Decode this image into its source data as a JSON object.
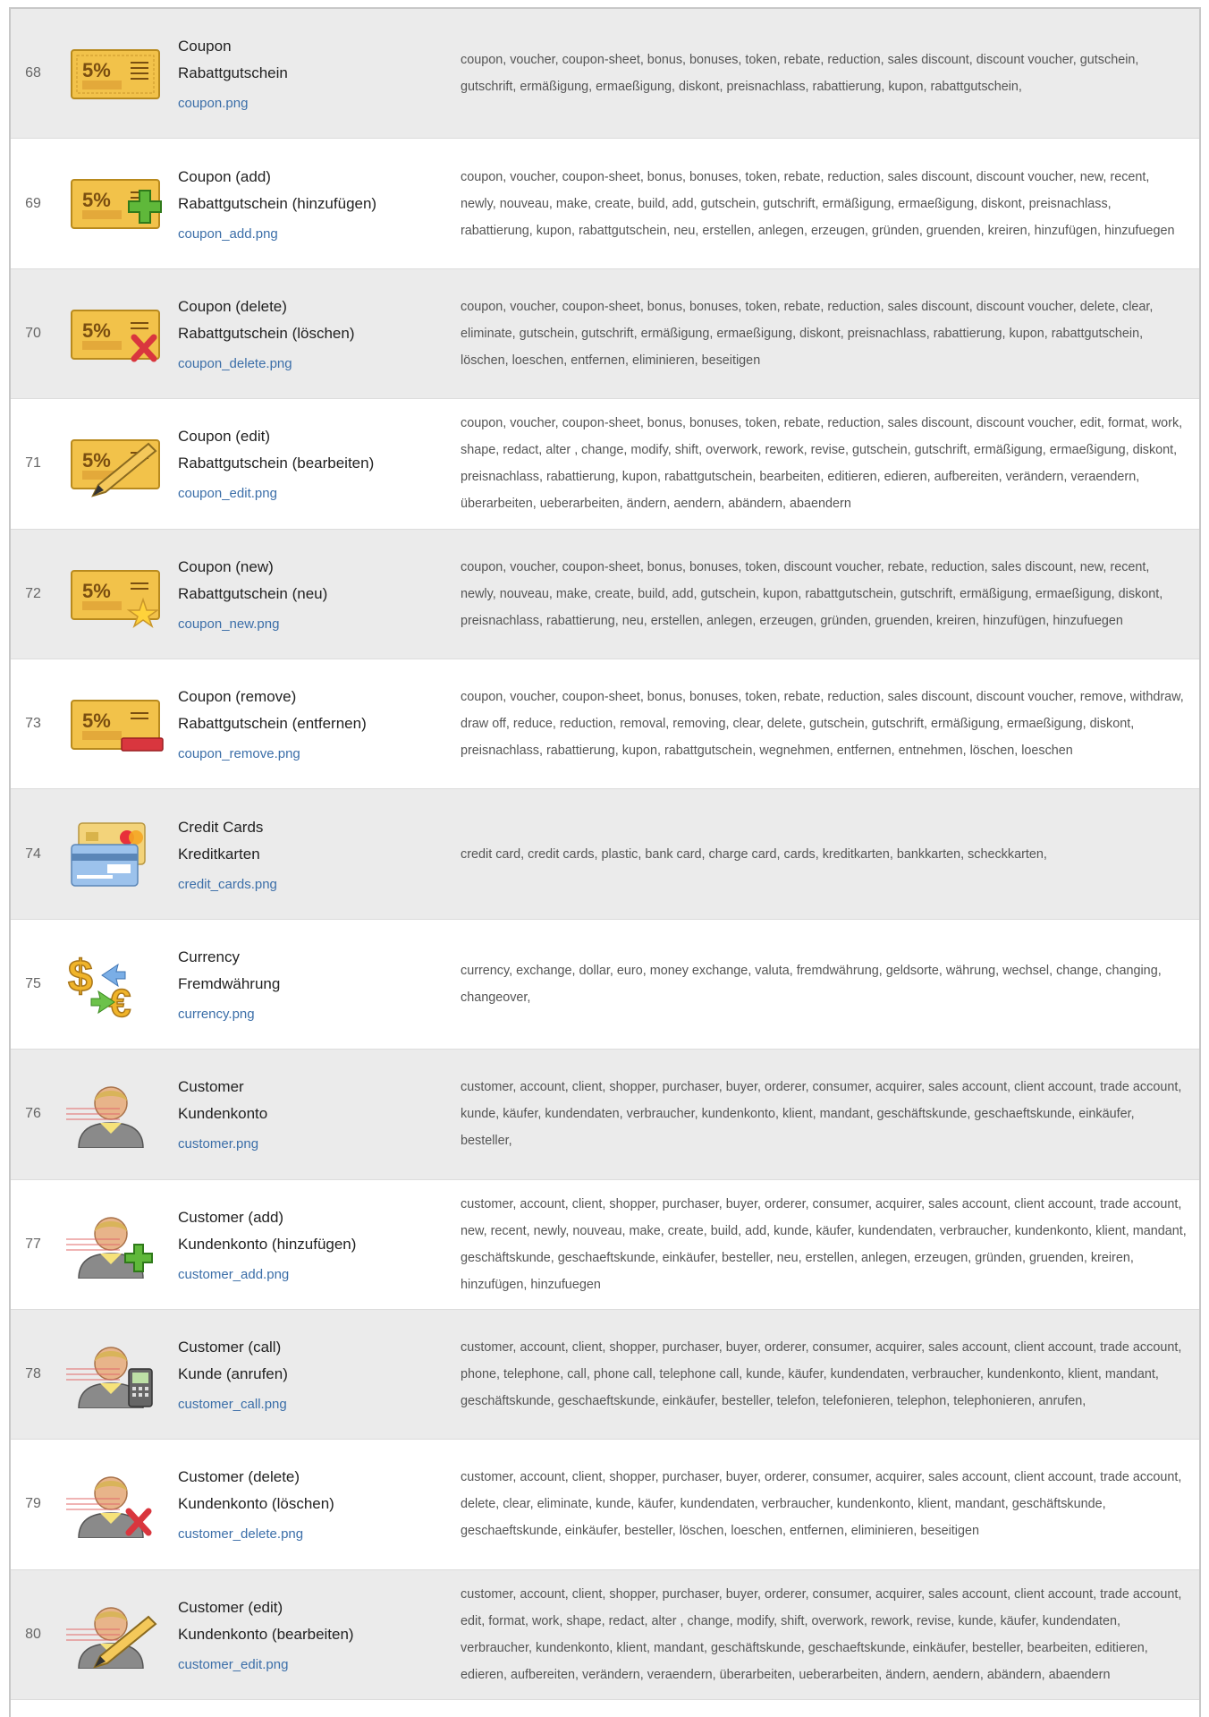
{
  "colors": {
    "row_odd": "#ebebeb",
    "row_even": "#ffffff",
    "link": "#3b6ea8",
    "coupon_gold": "#f2c24a",
    "add_green": "#5fb83a",
    "delete_red": "#d9363e"
  },
  "rows": [
    {
      "num": "68",
      "icon": "coupon-icon",
      "en": "Coupon",
      "de": "Rabattgutschein",
      "file": "coupon.png",
      "keywords": "coupon, voucher, coupon-sheet, bonus, bonuses, token, rebate, reduction, sales discount, discount voucher, gutschein, gutschrift, ermäßigung, ermaeßigung, diskont, preisnachlass, rabattierung, kupon, rabattgutschein,"
    },
    {
      "num": "69",
      "icon": "coupon-add-icon",
      "en": "Coupon (add)",
      "de": "Rabattgutschein (hinzufügen)",
      "file": "coupon_add.png",
      "keywords": "coupon, voucher, coupon-sheet, bonus, bonuses, token, rebate, reduction, sales discount, discount voucher, new, recent, newly, nouveau, make, create, build, add, gutschein, gutschrift, ermäßigung, ermaeßigung, diskont, preisnachlass, rabattierung, kupon, rabattgutschein, neu, erstellen, anlegen, erzeugen, gründen, gruenden, kreiren, hinzufügen, hinzufuegen"
    },
    {
      "num": "70",
      "icon": "coupon-delete-icon",
      "en": "Coupon (delete)",
      "de": "Rabattgutschein (löschen)",
      "file": "coupon_delete.png",
      "keywords": "coupon, voucher, coupon-sheet, bonus, bonuses, token, rebate, reduction, sales discount, discount voucher, delete, clear, eliminate, gutschein, gutschrift, ermäßigung, ermaeßigung, diskont, preisnachlass, rabattierung, kupon, rabattgutschein, löschen, loeschen, entfernen, eliminieren, beseitigen"
    },
    {
      "num": "71",
      "icon": "coupon-edit-icon",
      "en": "Coupon (edit)",
      "de": "Rabattgutschein (bearbeiten)",
      "file": "coupon_edit.png",
      "keywords": "coupon, voucher, coupon-sheet, bonus, bonuses, token, rebate, reduction, sales discount, discount voucher, edit, format, work, shape, redact, alter , change, modify, shift, overwork, rework, revise, gutschein, gutschrift, ermäßigung, ermaeßigung, diskont, preisnachlass, rabattierung, kupon, rabattgutschein, bearbeiten, editieren, edieren, aufbereiten, verändern, veraendern, überarbeiten, ueberarbeiten, ändern, aendern, abändern, abaendern"
    },
    {
      "num": "72",
      "icon": "coupon-new-icon",
      "en": "Coupon (new)",
      "de": "Rabattgutschein (neu)",
      "file": "coupon_new.png",
      "keywords": "coupon, voucher, coupon-sheet, bonus, bonuses, token, discount voucher, rebate, reduction, sales discount, new, recent, newly, nouveau, make, create, build, add, gutschein, kupon, rabattgutschein, gutschrift, ermäßigung, ermaeßigung, diskont, preisnachlass, rabattierung, neu, erstellen, anlegen, erzeugen, gründen, gruenden, kreiren, hinzufügen, hinzufuegen"
    },
    {
      "num": "73",
      "icon": "coupon-remove-icon",
      "en": "Coupon (remove)",
      "de": "Rabattgutschein (entfernen)",
      "file": "coupon_remove.png",
      "keywords": "coupon, voucher, coupon-sheet, bonus, bonuses, token, rebate, reduction, sales discount, discount voucher, remove, withdraw, draw off, reduce, reduction, removal, removing, clear, delete, gutschein, gutschrift, ermäßigung, ermaeßigung, diskont, preisnachlass, rabattierung, kupon, rabattgutschein, wegnehmen, entfernen, entnehmen, löschen, loeschen"
    },
    {
      "num": "74",
      "icon": "credit-cards-icon",
      "en": "Credit Cards",
      "de": "Kreditkarten",
      "file": "credit_cards.png",
      "keywords": "credit card, credit cards, plastic, bank card, charge card, cards, kreditkarten, bankkarten, scheckkarten,"
    },
    {
      "num": "75",
      "icon": "currency-icon",
      "en": "Currency",
      "de": "Fremdwährung",
      "file": "currency.png",
      "keywords": "currency, exchange, dollar, euro, money exchange, valuta, fremdwährung, geldsorte, währung, wechsel, change, changing, changeover,"
    },
    {
      "num": "76",
      "icon": "customer-icon",
      "en": "Customer",
      "de": "Kundenkonto",
      "file": "customer.png",
      "keywords": "customer, account, client, shopper, purchaser, buyer, orderer, consumer, acquirer, sales account, client account, trade account, kunde, käufer, kundendaten, verbraucher, kundenkonto, klient, mandant, geschäftskunde, geschaeftskunde, einkäufer, besteller,"
    },
    {
      "num": "77",
      "icon": "customer-add-icon",
      "en": "Customer (add)",
      "de": "Kundenkonto (hinzufügen)",
      "file": "customer_add.png",
      "keywords": "customer, account, client, shopper, purchaser, buyer, orderer, consumer, acquirer, sales account, client account, trade account, new, recent, newly, nouveau, make, create, build, add, kunde, käufer, kundendaten, verbraucher, kundenkonto, klient, mandant, geschäftskunde, geschaeftskunde, einkäufer, besteller, neu, erstellen, anlegen, erzeugen, gründen, gruenden, kreiren, hinzufügen, hinzufuegen"
    },
    {
      "num": "78",
      "icon": "customer-call-icon",
      "en": "Customer (call)",
      "de": "Kunde (anrufen)",
      "file": "customer_call.png",
      "keywords": "customer, account, client, shopper, purchaser, buyer, orderer, consumer, acquirer, sales account, client account, trade account, phone, telephone, call, phone call, telephone call, kunde, käufer, kundendaten, verbraucher, kundenkonto, klient, mandant, geschäftskunde, geschaeftskunde, einkäufer, besteller, telefon, telefonieren, telephon, telephonieren, anrufen,"
    },
    {
      "num": "79",
      "icon": "customer-delete-icon",
      "en": "Customer (delete)",
      "de": "Kundenkonto (löschen)",
      "file": "customer_delete.png",
      "keywords": "customer, account, client, shopper, purchaser, buyer, orderer, consumer, acquirer, sales account, client account, trade account, delete, clear, eliminate, kunde, käufer, kundendaten, verbraucher, kundenkonto, klient, mandant, geschäftskunde, geschaeftskunde, einkäufer, besteller, löschen, loeschen, entfernen, eliminieren, beseitigen"
    },
    {
      "num": "80",
      "icon": "customer-edit-icon",
      "en": "Customer (edit)",
      "de": "Kundenkonto (bearbeiten)",
      "file": "customer_edit.png",
      "keywords": "customer, account, client, shopper, purchaser, buyer, orderer, consumer, acquirer, sales account, client account, trade account, edit, format, work, shape, redact, alter , change, modify, shift, overwork, rework, revise, kunde, käufer, kundendaten, verbraucher, kundenkonto, klient, mandant, geschäftskunde, geschaeftskunde, einkäufer, besteller, bearbeiten, editieren, edieren, aufbereiten, verändern, veraendern, überarbeiten, ueberarbeiten, ändern, aendern, abändern, abaendern"
    }
  ]
}
